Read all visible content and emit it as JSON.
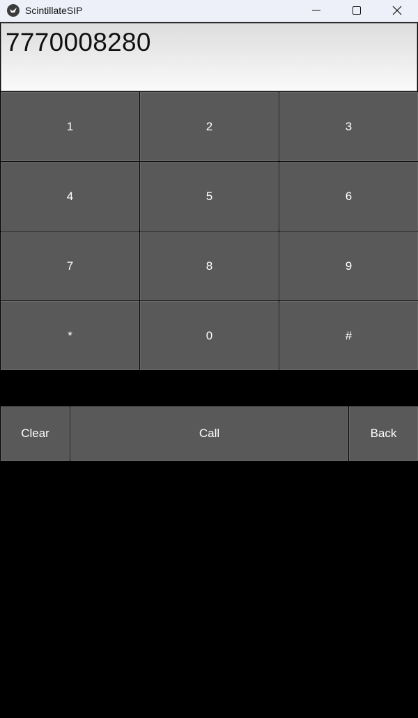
{
  "window": {
    "title": "ScintillateSIP",
    "icon": "kivy-app-icon",
    "controls": [
      "minimize-icon",
      "maximize-icon",
      "close-icon"
    ]
  },
  "display": {
    "number": "7770008280"
  },
  "keypad": {
    "keys": [
      "1",
      "2",
      "3",
      "4",
      "5",
      "6",
      "7",
      "8",
      "9",
      "*",
      "0",
      "#"
    ]
  },
  "actions": {
    "clear_label": "Clear",
    "call_label": "Call",
    "back_label": "Back"
  },
  "colors": {
    "key_bg": "#595959",
    "background": "#000000",
    "key_text": "#ffffff"
  }
}
